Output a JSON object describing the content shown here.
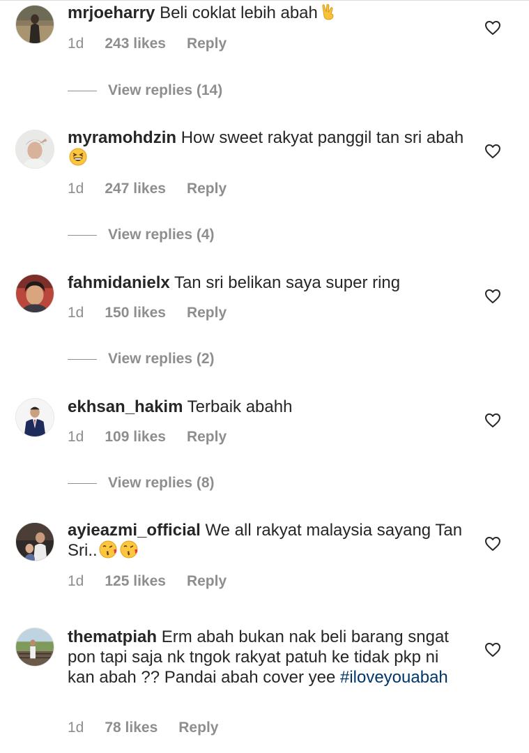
{
  "comments": [
    {
      "username": "mrjoeharry",
      "text": "Beli coklat lebih abah",
      "emoji": "victory-hand",
      "time": "1d",
      "likes": "243 likes",
      "reply": "Reply",
      "view_replies": "View replies (14)"
    },
    {
      "username": "myramohdzin",
      "text": "How sweet rakyat panggil tan sri abah",
      "emoji": "grinning-squinting-face",
      "time": "1d",
      "likes": "247 likes",
      "reply": "Reply",
      "view_replies": "View replies (4)"
    },
    {
      "username": "fahmidanielx",
      "text": "Tan sri belikan saya super ring",
      "time": "1d",
      "likes": "150 likes",
      "reply": "Reply",
      "view_replies": "View replies (2)"
    },
    {
      "username": "ekhsan_hakim",
      "text": "Terbaik abahh",
      "time": "1d",
      "likes": "109 likes",
      "reply": "Reply",
      "view_replies": "View replies (8)"
    },
    {
      "username": "ayieazmi_official",
      "text": "We all rakyat malaysia sayang Tan Sri..",
      "emoji": "face-blowing-kiss",
      "time": "1d",
      "likes": "125 likes",
      "reply": "Reply"
    },
    {
      "username": "thematpiah",
      "text": "Erm abah bukan nak beli barang sngat pon tapi saja nk tngok rakyat patuh ke tidak pkp ni kan abah ?? Pandai abah cover yee",
      "hashtag": "#iloveyouabah",
      "time": "1d",
      "likes": "78 likes",
      "reply": "Reply"
    }
  ],
  "icons": {
    "like": "heart-outline-icon"
  },
  "colors": {
    "text": "#262626",
    "secondary": "#8e8e8e",
    "hashtag": "#00376b"
  }
}
